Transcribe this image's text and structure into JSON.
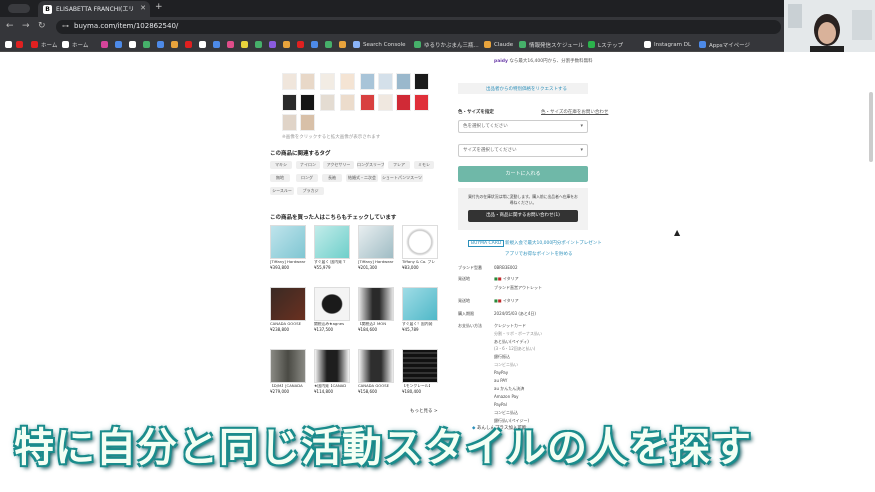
{
  "tab": {
    "title": "ELISABETTA FRANCHI(エリ",
    "favicon": "B"
  },
  "address": {
    "url": "buyma.com/item/102862540/"
  },
  "bookmarks": [
    "ホーム",
    "ホーム",
    "Search Console",
    "ゆるりかぶまん三瓶...",
    "Claude",
    "情報発信スケジュール",
    "Lステップ",
    "Instagram DL",
    "Appsマイページ"
  ],
  "page": {
    "thumb_caption": "※画像をクリックすると拡大画像が表示されます",
    "tags_title": "この商品に関連するタグ",
    "tags": [
      "マキシ",
      "ナイロン",
      "アクセサリー",
      "ロングスリーブ",
      "フレア",
      "ミモレ",
      "無地",
      "ロング",
      "長袖",
      "結婚式・二次会",
      "ショートパンツスーツ",
      "シースルー",
      "プラカジ"
    ],
    "recs_title": "この商品を買った人はこちらもチェックしています",
    "products": [
      {
        "name": "[Tiffany] Hardwear",
        "price": "¥393,800"
      },
      {
        "name": "すぐ届く 国内発 T",
        "price": "¥55,979"
      },
      {
        "name": "[Tiffany] Hardwear",
        "price": "¥201,300"
      },
      {
        "name": "Tiffany & Co. ブレ",
        "price": "¥83,000"
      },
      {
        "name": "CANADA GOOSE",
        "price": "¥238,800"
      },
      {
        "name": "関税込み★agnes",
        "price": "¥137,500"
      },
      {
        "name": "【関税込】MON",
        "price": "¥184,600"
      },
      {
        "name": "すぐ届く！国内発",
        "price": "¥45,789"
      },
      {
        "name": "【D/M】[CANADA",
        "price": "¥279,000"
      },
      {
        "name": "★国内発【CANAD",
        "price": "¥114,800"
      },
      {
        "name": "CANADA GOOSE",
        "price": "¥158,600"
      },
      {
        "name": "【モンクレール】",
        "price": "¥180,400"
      }
    ],
    "more": "もっと見る >",
    "payment": {
      "brand": "paidy",
      "text": "なら最大16,400円から、分割手数料無料"
    },
    "coupon_link": "出品者からの特別価格をリクエストする",
    "size_label": "色・サイズを指定",
    "size_link": "色・サイズの在庫をお問い合わせ",
    "color_select": "色を選択してください",
    "size_select": "サイズを選択してください",
    "cart_button": "カートに入れる",
    "notice": "買付先の在庫状況は常に変動します。購入前に出品者へ在庫をお尋ねください。",
    "inquiry_button": "出品・商品に関するお問い合わせ(1)",
    "badge": "BUYMA CARD",
    "badge_text": "新規入会で最大10,000円分ポイントプレゼント",
    "badge2_text": "アプリでお得なポイントを貯める",
    "info": [
      {
        "k": "ブランド型番",
        "v": "0BRB3E002"
      },
      {
        "k": "発送地",
        "v": "イタリア"
      },
      {
        "k": "",
        "v": "ブランド直営アウトレット"
      },
      {
        "k": "発送地",
        "v": "イタリア"
      },
      {
        "k": "購入期限",
        "v": "2024/05/03 (あと4日)"
      },
      {
        "k": "お支払い方法",
        "v": "クレジットカード"
      }
    ],
    "pay_methods": [
      "分割・リボ・ボーナス払い",
      "あと払い(ペイディ)",
      "(3・6・12回あと払い)",
      "銀行振込",
      "コンビニ払い",
      "PayPay",
      "au PAY",
      "au かんたん決済",
      "Amazon Pay",
      "PayPal",
      "コンビニ払込",
      "銀行払い(ペイジー)"
    ],
    "bottom_note": "あんしんプラス加入可能"
  },
  "caption": "特に自分と同じ活動スタイルの人を探す"
}
